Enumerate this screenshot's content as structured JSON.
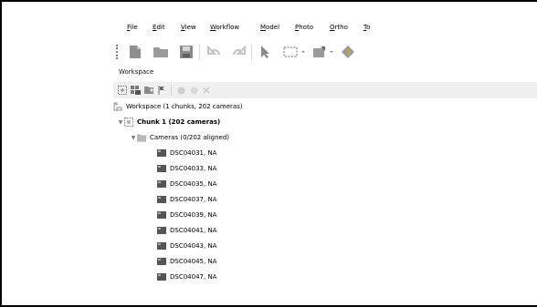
{
  "menu": [
    "File",
    "Edit",
    "View",
    "Workflow",
    "Model",
    "Photo",
    "Ortho",
    "To"
  ],
  "panel": {
    "title": "Workspace"
  },
  "tree": {
    "root": "Workspace (1 chunks, 202 cameras)",
    "chunk": "Chunk 1 (202 cameras)",
    "cameras": "Cameras (0/202 aligned)",
    "images": [
      "DSC04031, NA",
      "DSC04033, NA",
      "DSC04035, NA",
      "DSC04037, NA",
      "DSC04039, NA",
      "DSC04041, NA",
      "DSC04043, NA",
      "DSC04045, NA",
      "DSC04047, NA"
    ]
  },
  "colors": {
    "icon_gray": "#8a8a8a",
    "icon_dark": "#555555",
    "folder": "#b8b8b8"
  }
}
